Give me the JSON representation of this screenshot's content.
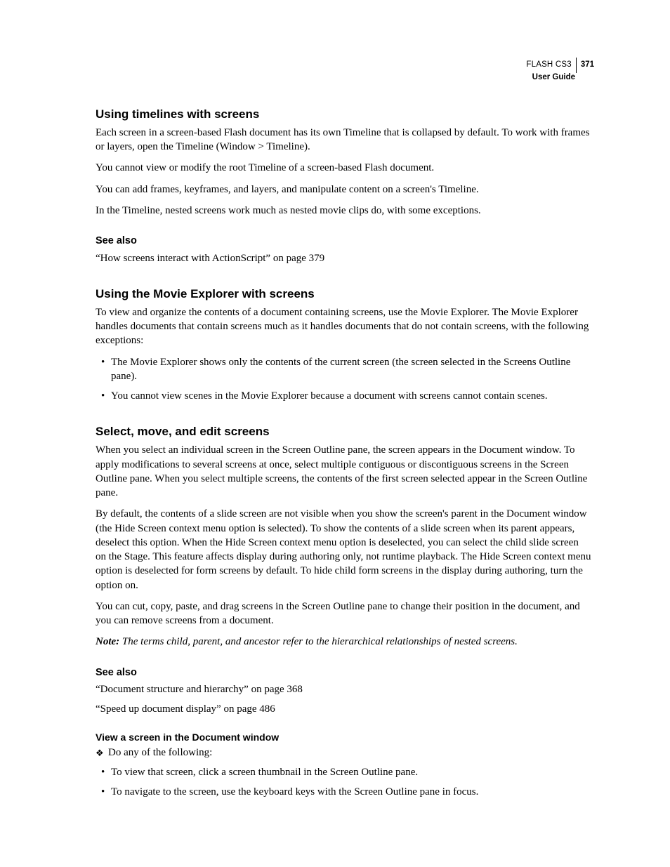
{
  "header": {
    "product": "FLASH CS3",
    "page_number": "371",
    "guide": "User Guide"
  },
  "sections": [
    {
      "heading": "Using timelines with screens",
      "paragraphs": [
        "Each screen in a screen-based Flash document has its own Timeline that is collapsed by default. To work with frames or layers, open the Timeline (Window > Timeline).",
        "You cannot view or modify the root Timeline of a screen-based Flash document.",
        "You can add frames, keyframes, and layers, and manipulate content on a screen's Timeline.",
        "In the Timeline, nested screens work much as nested movie clips do, with some exceptions."
      ],
      "see_also_heading": "See also",
      "see_also": [
        "“How screens interact with ActionScript” on page 379"
      ]
    },
    {
      "heading": "Using the Movie Explorer with screens",
      "paragraphs": [
        "To view and organize the contents of a document containing screens, use the Movie Explorer. The Movie Explorer handles documents that contain screens much as it handles documents that do not contain screens, with the following exceptions:"
      ],
      "bullets": [
        "The Movie Explorer shows only the contents of the current screen (the screen selected in the Screens Outline pane).",
        "You cannot view scenes in the Movie Explorer because a document with screens cannot contain scenes."
      ]
    },
    {
      "heading": "Select, move, and edit screens",
      "paragraphs": [
        "When you select an individual screen in the Screen Outline pane, the screen appears in the Document window. To apply modifications to several screens at once, select multiple contiguous or discontiguous screens in the Screen Outline pane. When you select multiple screens, the contents of the first screen selected appear in the Screen Outline pane.",
        "By default, the contents of a slide screen are not visible when you show the screen's parent in the Document window (the Hide Screen context menu option is selected). To show the contents of a slide screen when its parent appears, deselect this option. When the Hide Screen context menu option is deselected, you can select the child slide screen on the Stage. This feature affects display during authoring only, not runtime playback. The Hide Screen context menu option is deselected for form screens by default. To hide child form screens in the display during authoring, turn the option on.",
        "You can cut, copy, paste, and drag screens in the Screen Outline pane to change their position in the document, and you can remove screens from a document."
      ],
      "note_label": "Note:",
      "note_text": " The terms child, parent, and ancestor refer to the hierarchical relationships of nested screens.",
      "see_also_heading": "See also",
      "see_also": [
        "“Document structure and hierarchy” on page 368",
        "“Speed up document display” on page 486"
      ],
      "procedure_heading": "View a screen in the Document window",
      "procedure_lead": "Do any of the following:",
      "procedure_bullets": [
        "To view that screen, click a screen thumbnail in the Screen Outline pane.",
        "To navigate to the screen, use the keyboard keys with the Screen Outline pane in focus."
      ]
    }
  ]
}
